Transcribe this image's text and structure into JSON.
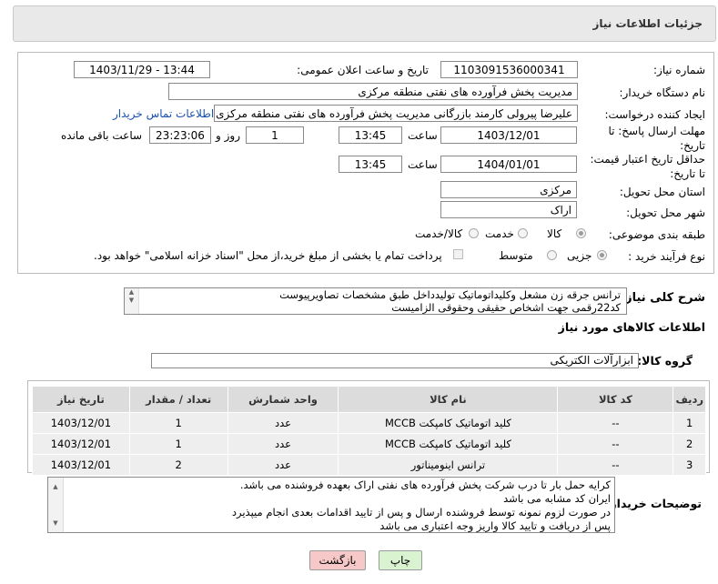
{
  "title": "جزئیات اطلاعات نیاز",
  "fields": {
    "need_number_label": "شماره نیاز:",
    "need_number": "1103091536000341",
    "announce_label": "تاریخ و ساعت اعلان عمومی:",
    "announce_value": "1403/11/29 - 13:44",
    "buyer_label": "نام دستگاه خریدار:",
    "buyer_value": "مدیریت پخش فرآورده های نفتی منطقه مرکزی",
    "creator_label": "ایجاد کننده درخواست:",
    "creator_value": "علیرضا پیرولی کارمند بازرگانی مدیریت پخش فرآورده های نفتی منطقه مرکزی",
    "contact_link": "اطلاعات تماس خریدار",
    "deadline_label": "مهلت ارسال پاسخ: تا تاریخ:",
    "deadline_date": "1403/12/01",
    "time_word": "ساعت",
    "deadline_time": "13:45",
    "days_value": "1",
    "days_word": "روز و",
    "remaining_time": "23:23:06",
    "remaining_word": "ساعت باقی مانده",
    "validity_label": "حداقل تاریخ اعتبار قیمت: تا تاریخ:",
    "validity_date": "1404/01/01",
    "validity_time": "13:45",
    "province_label": "استان محل تحویل:",
    "province_value": "مرکزی",
    "city_label": "شهر محل تحویل:",
    "city_value": "اراک",
    "category_label": "طبقه بندی موضوعی:",
    "category_options": [
      "کالا",
      "خدمت",
      "کالا/خدمت"
    ],
    "process_label": "نوع فرآیند خرید :",
    "process_options": [
      "جزیی",
      "متوسط"
    ],
    "process_note": "پرداخت تمام یا بخشی از مبلغ خرید،از محل \"اسناد خزانه اسلامی\" خواهد بود."
  },
  "description": {
    "label": "شرح کلی نیاز:",
    "line1": "ترانس جرقه زن مشعل وکلیداتوماتیک تولیدداخل طبق مشخصات تصاویرپیوست",
    "line2": "کد22رقمی  جهت اشخاص حقیقی وحقوقی الزامیست"
  },
  "goods": {
    "section_title": "اطلاعات کالاهای مورد نیاز",
    "group_label": "گروه کالا:",
    "group_value": "ابزارآلات الکتریکی",
    "columns": [
      "ردیف",
      "کد کالا",
      "نام کالا",
      "واحد شمارش",
      "تعداد / مقدار",
      "تاریخ نیاز"
    ],
    "rows": [
      {
        "row": "1",
        "code": "--",
        "name": "کلید اتوماتیک کامپکت MCCB",
        "unit": "عدد",
        "qty": "1",
        "date": "1403/12/01"
      },
      {
        "row": "2",
        "code": "--",
        "name": "کلید اتوماتیک کامپکت MCCB",
        "unit": "عدد",
        "qty": "1",
        "date": "1403/12/01"
      },
      {
        "row": "3",
        "code": "--",
        "name": "ترانس اینومیناتور",
        "unit": "عدد",
        "qty": "2",
        "date": "1403/12/01"
      }
    ]
  },
  "buyer_notes": {
    "label": "توضیحات خریدار:",
    "lines": [
      "کرایه حمل بار تا درب شرکت  پخش فرآورده های نفتی اراک بعهده فروشنده می باشد.",
      "ایران کد مشابه می باشد",
      "در صورت لزوم نمونه توسط فروشنده ارسال و پس از تایید اقدامات بعدی انجام میپذیرد",
      "پس از دریافت و تایید کالا واریز وجه اعتباری می باشد"
    ]
  },
  "buttons": {
    "print": "چاپ",
    "back": "بازگشت"
  },
  "colors": {
    "header_bg": "#e8e8e8",
    "link": "#1a4fb0",
    "print_bg": "#d9f2d0",
    "back_bg": "#f6c8c8"
  }
}
